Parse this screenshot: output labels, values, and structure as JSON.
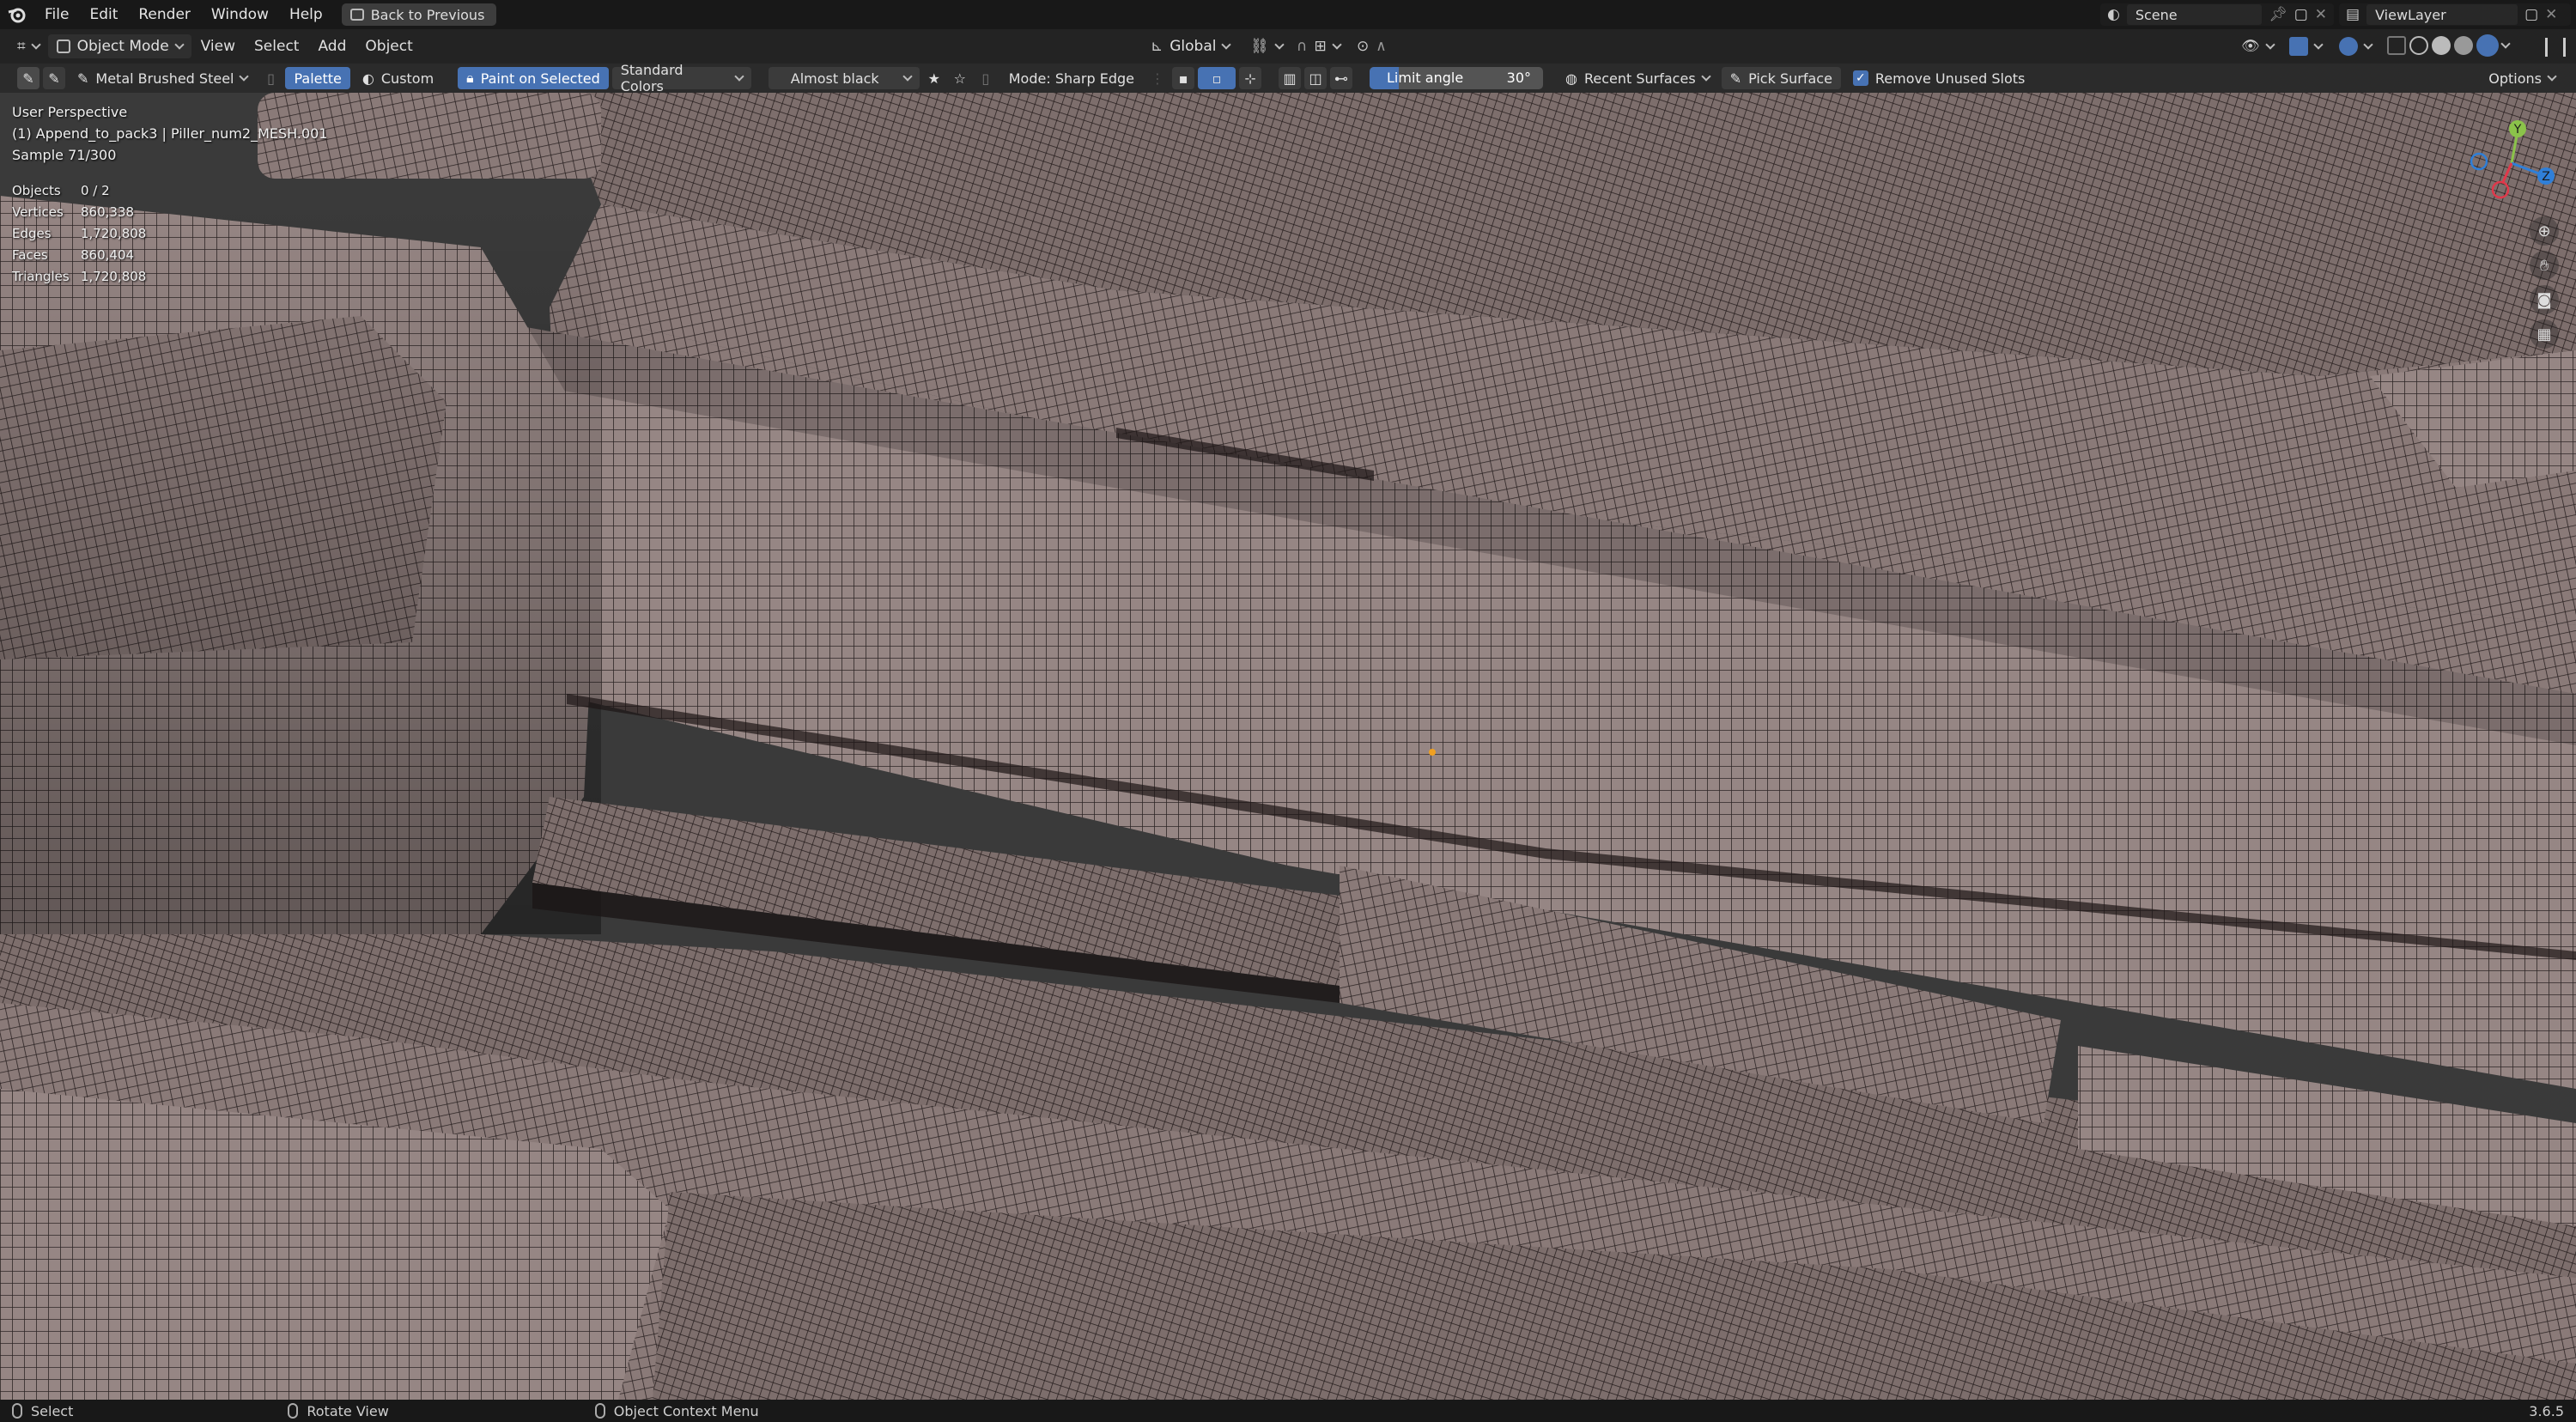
{
  "menubar": {
    "items": [
      "File",
      "Edit",
      "Render",
      "Window",
      "Help"
    ],
    "back_button": "Back to Previous",
    "scene": "Scene",
    "view_layer": "ViewLayer"
  },
  "header": {
    "mode": "Object Mode",
    "menus": [
      "View",
      "Select",
      "Add",
      "Object"
    ],
    "transform_orientation": "Global"
  },
  "tool_settings": {
    "material": "Metal Brushed Steel",
    "palette": "Palette",
    "custom": "Custom",
    "paint_on_selected": "Paint on Selected",
    "color_set": "Standard Colors",
    "color": "Almost black",
    "mode": "Mode: Sharp Edge",
    "limit_angle_label": "Limit angle",
    "limit_angle_value": "30°",
    "limit_angle_fraction": 0.17,
    "recent_surfaces": "Recent Surfaces",
    "pick_surface": "Pick Surface",
    "remove_unused_slots": "Remove Unused Slots",
    "options": "Options"
  },
  "viewport": {
    "view_name": "User Perspective",
    "object_name": "(1) Append_to_pack3 | Piller_num2_MESH.001",
    "sample": "Sample 71/300",
    "stats": [
      {
        "label": "Objects",
        "value": "0 / 2"
      },
      {
        "label": "Vertices",
        "value": "860,338"
      },
      {
        "label": "Edges",
        "value": "1,720,808"
      },
      {
        "label": "Faces",
        "value": "860,404"
      },
      {
        "label": "Triangles",
        "value": "1,720,808"
      }
    ],
    "gizmo_axes": [
      "Y",
      "Z"
    ]
  },
  "statusbar": {
    "select": "Select",
    "rotate_view": "Rotate View",
    "context_menu": "Object Context Menu",
    "version": "3.6.5"
  },
  "colors": {
    "accent": "#4772b3",
    "mesh_surface": "#8a7a78",
    "wire": "#2a2222",
    "axis_x": "#e0384a",
    "axis_y": "#8bc34a",
    "axis_z": "#2f7fd8"
  }
}
